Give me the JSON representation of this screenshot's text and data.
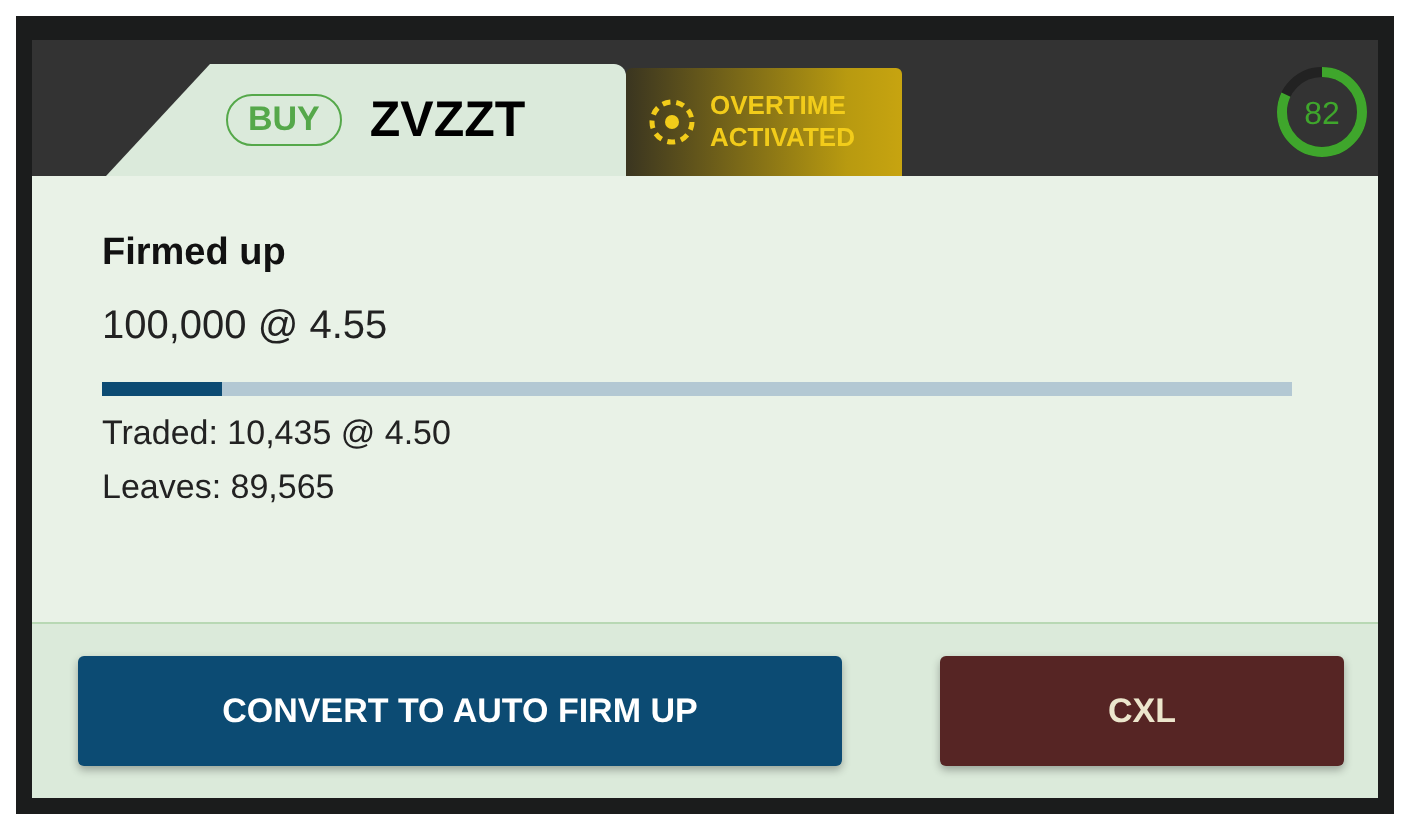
{
  "order_tab": {
    "side": "BUY",
    "symbol": "ZVZZT"
  },
  "overtime_badge": {
    "lines": [
      "OVERTIME",
      "ACTIVATED"
    ]
  },
  "score_gauge": {
    "value": "82",
    "level": 0.82
  },
  "order": {
    "status": "Firmed up",
    "quantity_price": "100,000 @ 4.55",
    "progress": {
      "level": 0.1
    },
    "traded": "Traded: 10,435 @ 4.50",
    "leaves": "Leaves: 89,565"
  },
  "buttons": [
    {
      "label": "CONVERT TO AUTO FIRM UP",
      "kind": "primary"
    },
    {
      "label": "CXL",
      "kind": "cancel"
    }
  ]
}
